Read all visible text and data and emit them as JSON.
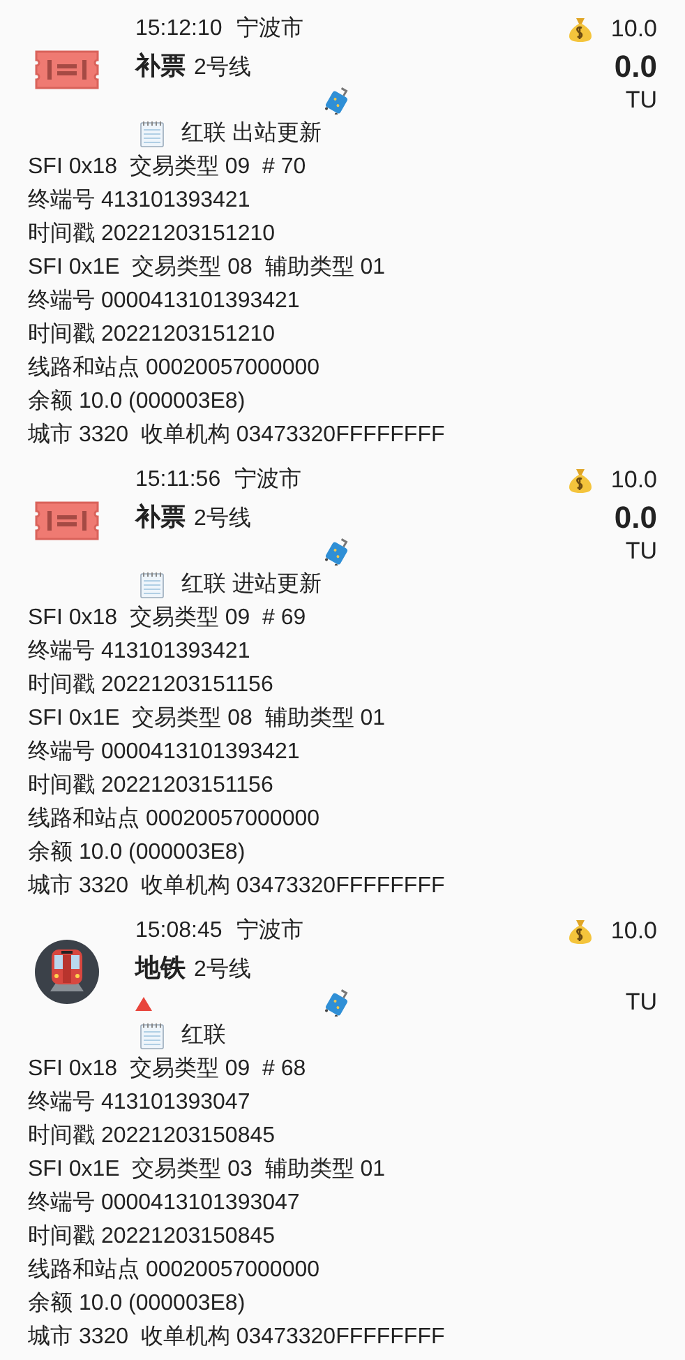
{
  "records": [
    {
      "kind": "ticket",
      "time": "15:12:10",
      "city": "宁波市",
      "balance": "10.0",
      "title": "补票",
      "line": "2号线",
      "fare": "0.0",
      "alert": false,
      "unit": "TU",
      "card": "红联 出站更新",
      "details": [
        "SFI 0x18  交易类型 09  # 70",
        "终端号 413101393421",
        "时间戳 20221203151210",
        "SFI 0x1E  交易类型 08  辅助类型 01",
        "终端号 0000413101393421",
        "时间戳 20221203151210",
        "线路和站点 00020057000000",
        "余额 10.0 (000003E8)",
        "城市 3320  收单机构 03473320FFFFFFFF"
      ]
    },
    {
      "kind": "ticket",
      "time": "15:11:56",
      "city": "宁波市",
      "balance": "10.0",
      "title": "补票",
      "line": "2号线",
      "fare": "0.0",
      "alert": false,
      "unit": "TU",
      "card": "红联 进站更新",
      "details": [
        "SFI 0x18  交易类型 09  # 69",
        "终端号 413101393421",
        "时间戳 20221203151156",
        "SFI 0x1E  交易类型 08  辅助类型 01",
        "终端号 0000413101393421",
        "时间戳 20221203151156",
        "线路和站点 00020057000000",
        "余额 10.0 (000003E8)",
        "城市 3320  收单机构 03473320FFFFFFFF"
      ]
    },
    {
      "kind": "metro",
      "time": "15:08:45",
      "city": "宁波市",
      "balance": "10.0",
      "title": "地铁",
      "line": "2号线",
      "alert": true,
      "unit": "TU",
      "card": "红联",
      "details": [
        "SFI 0x18  交易类型 09  # 68",
        "终端号 413101393047",
        "时间戳 20221203150845",
        "SFI 0x1E  交易类型 03  辅助类型 01",
        "终端号 0000413101393047",
        "时间戳 20221203150845",
        "线路和站点 00020057000000",
        "余额 10.0 (000003E8)",
        "城市 3320  收单机构 03473320FFFFFFFF"
      ]
    }
  ]
}
